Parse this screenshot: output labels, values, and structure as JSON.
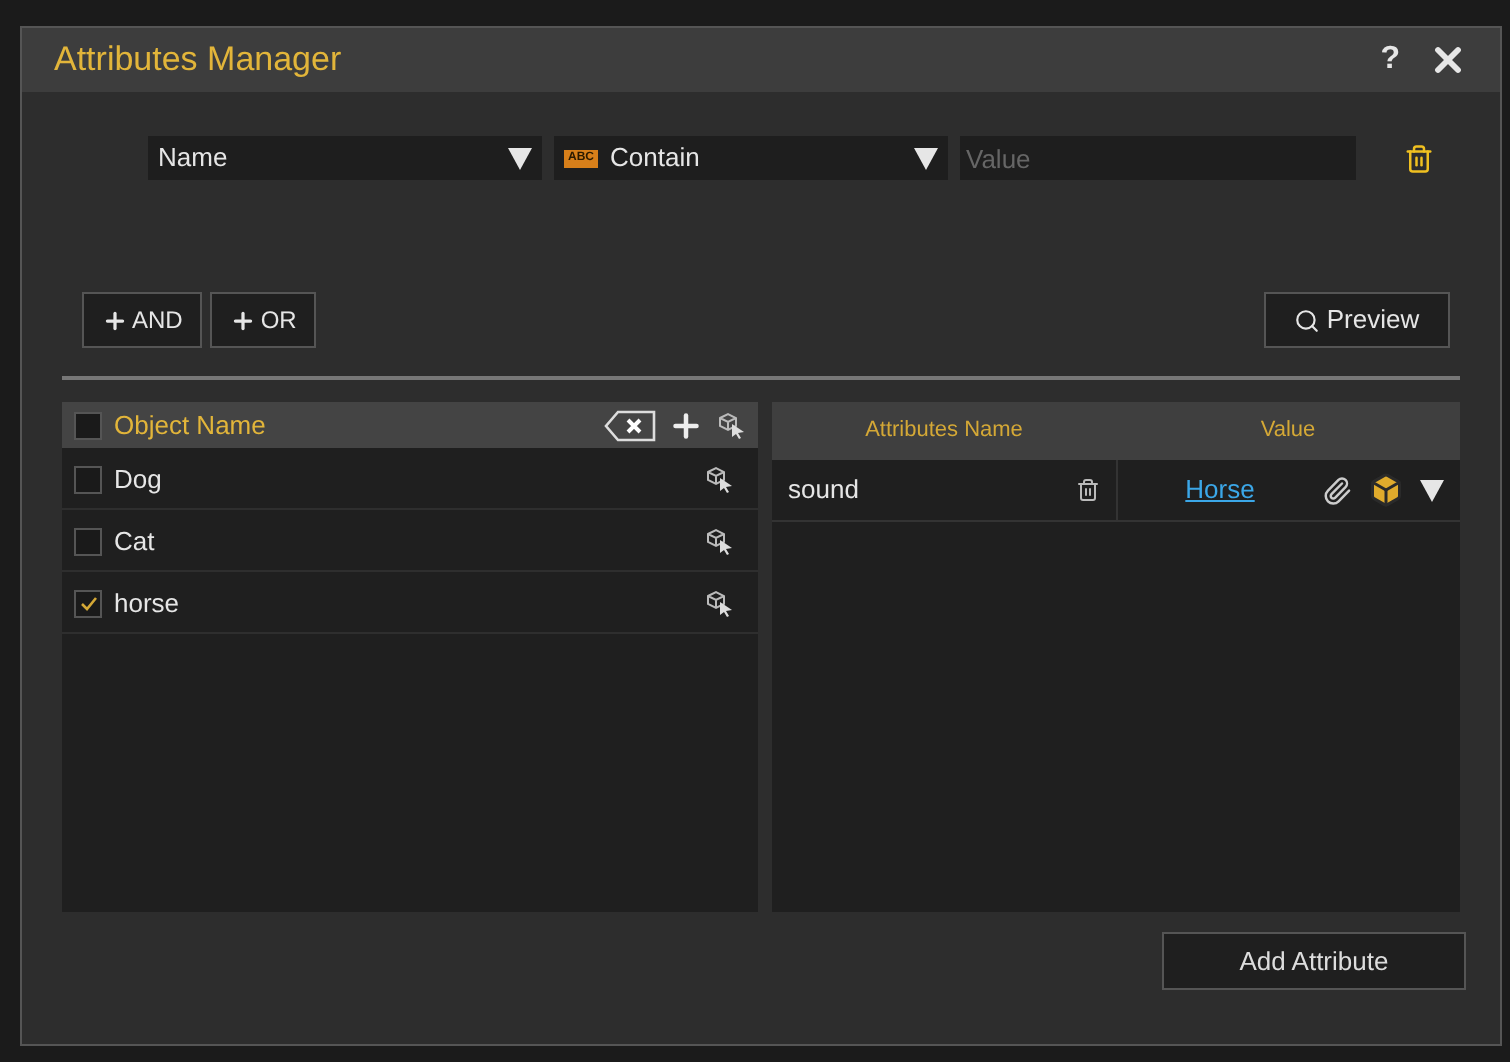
{
  "window": {
    "title": "Attributes Manager",
    "help": "?"
  },
  "filter": {
    "field": "Name",
    "operator": "Contain",
    "operator_badge": "ABC",
    "value_placeholder": "Value"
  },
  "logic_buttons": [
    "AND",
    "OR"
  ],
  "preview_button": "Preview",
  "objects": {
    "header": {
      "label": "Object Name",
      "checked": false
    },
    "rows": [
      {
        "name": "Dog",
        "checked": false
      },
      {
        "name": "Cat",
        "checked": false
      },
      {
        "name": "horse",
        "checked": true
      }
    ]
  },
  "attributes": {
    "columns": [
      "Attributes Name",
      "Value"
    ],
    "rows": [
      {
        "name": "sound",
        "value": "Horse"
      }
    ]
  },
  "add_button": "Add Attribute"
}
